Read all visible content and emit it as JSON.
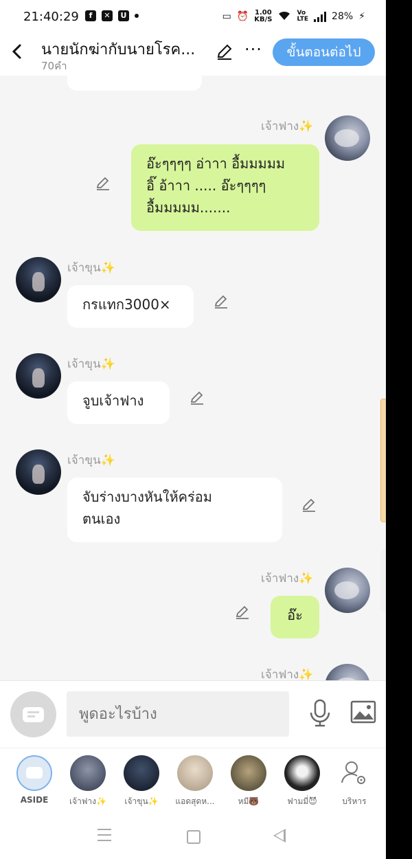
{
  "status_bar": {
    "time": "21:40:29",
    "network_speed_value": "1.00",
    "network_speed_unit": "KB/S",
    "battery": "28%"
  },
  "header": {
    "title": "นายนักฆ่ากับนายโรค...",
    "subtitle": "70คำ",
    "next_button": "ขั้นตอนต่อไป"
  },
  "messages": [
    {
      "speaker": "เจ้าฟาง",
      "side": "right",
      "text_lines": [
        "อ๊ะๆๆๆๆ  อ่าาา อื้มมมมม",
        "อิ๊  อ้าาา  ..... อ๊ะๆๆๆๆ",
        "อื้มมมมม......."
      ]
    },
    {
      "speaker": "เจ้าขุน",
      "side": "left",
      "text_lines": [
        "กรแทก3000×"
      ]
    },
    {
      "speaker": "เจ้าขุน",
      "side": "left",
      "text_lines": [
        "จูบเจ้าฟาง"
      ]
    },
    {
      "speaker": "เจ้าขุน",
      "side": "left",
      "text_lines": [
        "จับร่างบางหันให้คร่อม",
        "ตนเอง"
      ]
    },
    {
      "speaker": "เจ้าฟาง",
      "side": "right",
      "text_lines": [
        "อ๊ะ"
      ]
    },
    {
      "speaker": "เจ้าฟาง",
      "side": "right",
      "text_lines": []
    }
  ],
  "sparkle": "✨",
  "input": {
    "placeholder": "พูดอะไรบ้าง"
  },
  "characters": [
    {
      "label": "ASIDE"
    },
    {
      "label": "เจ้าฟาง✨"
    },
    {
      "label": "เจ้าขุน✨"
    },
    {
      "label": "แอดสุดห..."
    },
    {
      "label": "หมี🐻"
    },
    {
      "label": "ฟามมี่😈"
    },
    {
      "label": "บริหาร"
    }
  ],
  "colors": {
    "accent": "#5aa5f0",
    "my_bubble": "#d7f59b",
    "other_bubble": "#ffffff",
    "background": "#f5f5f5"
  }
}
